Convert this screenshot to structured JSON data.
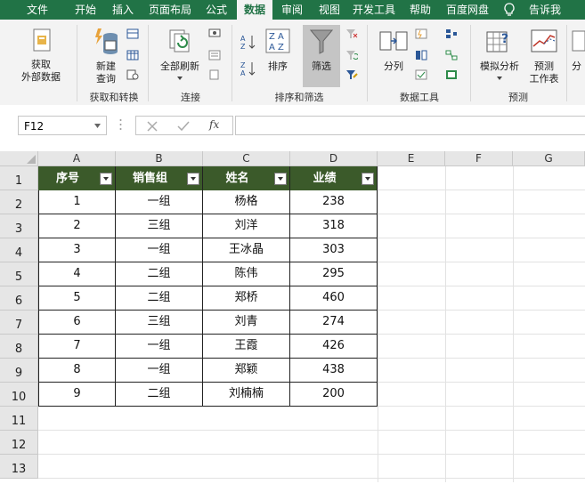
{
  "tabs": [
    "文件",
    "开始",
    "插入",
    "页面布局",
    "公式",
    "数据",
    "审阅",
    "视图",
    "开发工具",
    "帮助",
    "百度网盘",
    "告诉我"
  ],
  "ribbon": {
    "get_external": [
      "获取",
      "外部数据"
    ],
    "new_query": [
      "新建",
      "查询"
    ],
    "refresh_all": "全部刷新",
    "sort": "排序",
    "filter": "筛选",
    "split": "分列",
    "whatif": "模拟分析",
    "forecast": [
      "预测",
      "工作表"
    ],
    "more": "分",
    "groups": {
      "get_transform": "获取和转换",
      "connections": "连接",
      "sort_filter": "排序和筛选",
      "data_tools": "数据工具",
      "forecast": "预测"
    }
  },
  "namebox": "F12",
  "fx": "fx",
  "columns": [
    "A",
    "B",
    "C",
    "D",
    "E",
    "F",
    "G"
  ],
  "rows": [
    "1",
    "2",
    "3",
    "4",
    "5",
    "6",
    "7",
    "8",
    "9",
    "10",
    "11",
    "12",
    "13"
  ],
  "table_header": [
    "序号",
    "销售组",
    "姓名",
    "业绩"
  ],
  "table_rows": [
    [
      "1",
      "一组",
      "杨格",
      "238"
    ],
    [
      "2",
      "三组",
      "刘洋",
      "318"
    ],
    [
      "3",
      "一组",
      "王冰晶",
      "303"
    ],
    [
      "4",
      "二组",
      "陈伟",
      "295"
    ],
    [
      "5",
      "二组",
      "郑桥",
      "460"
    ],
    [
      "6",
      "三组",
      "刘青",
      "274"
    ],
    [
      "7",
      "一组",
      "王霞",
      "426"
    ],
    [
      "8",
      "一组",
      "郑颖",
      "438"
    ],
    [
      "9",
      "二组",
      "刘楠楠",
      "200"
    ]
  ],
  "colors": {
    "accent": "#217346",
    "header_fill": "#3b5a2a"
  }
}
